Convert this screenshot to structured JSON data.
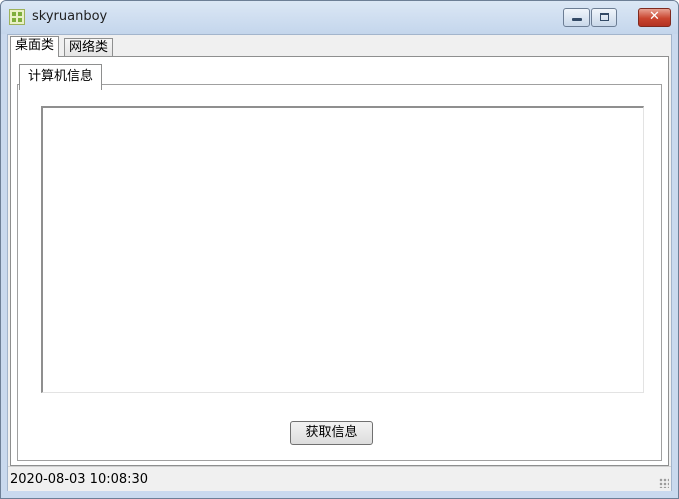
{
  "window": {
    "title": "skyruanboy",
    "icon": "app-icon"
  },
  "tabs": {
    "outer": [
      {
        "label": "桌面类",
        "selected": true
      },
      {
        "label": "网络类",
        "selected": false
      }
    ],
    "inner": [
      {
        "label": "计算机信息",
        "selected": true
      }
    ]
  },
  "output_box": {
    "value": ""
  },
  "button": {
    "get_info_label": "获取信息"
  },
  "status": {
    "datetime": "2020-08-03 10:08:30"
  },
  "colors": {
    "titlebar": "#c4d6ec",
    "close_button": "#c9452f",
    "client_background": "#f0f0f0"
  }
}
